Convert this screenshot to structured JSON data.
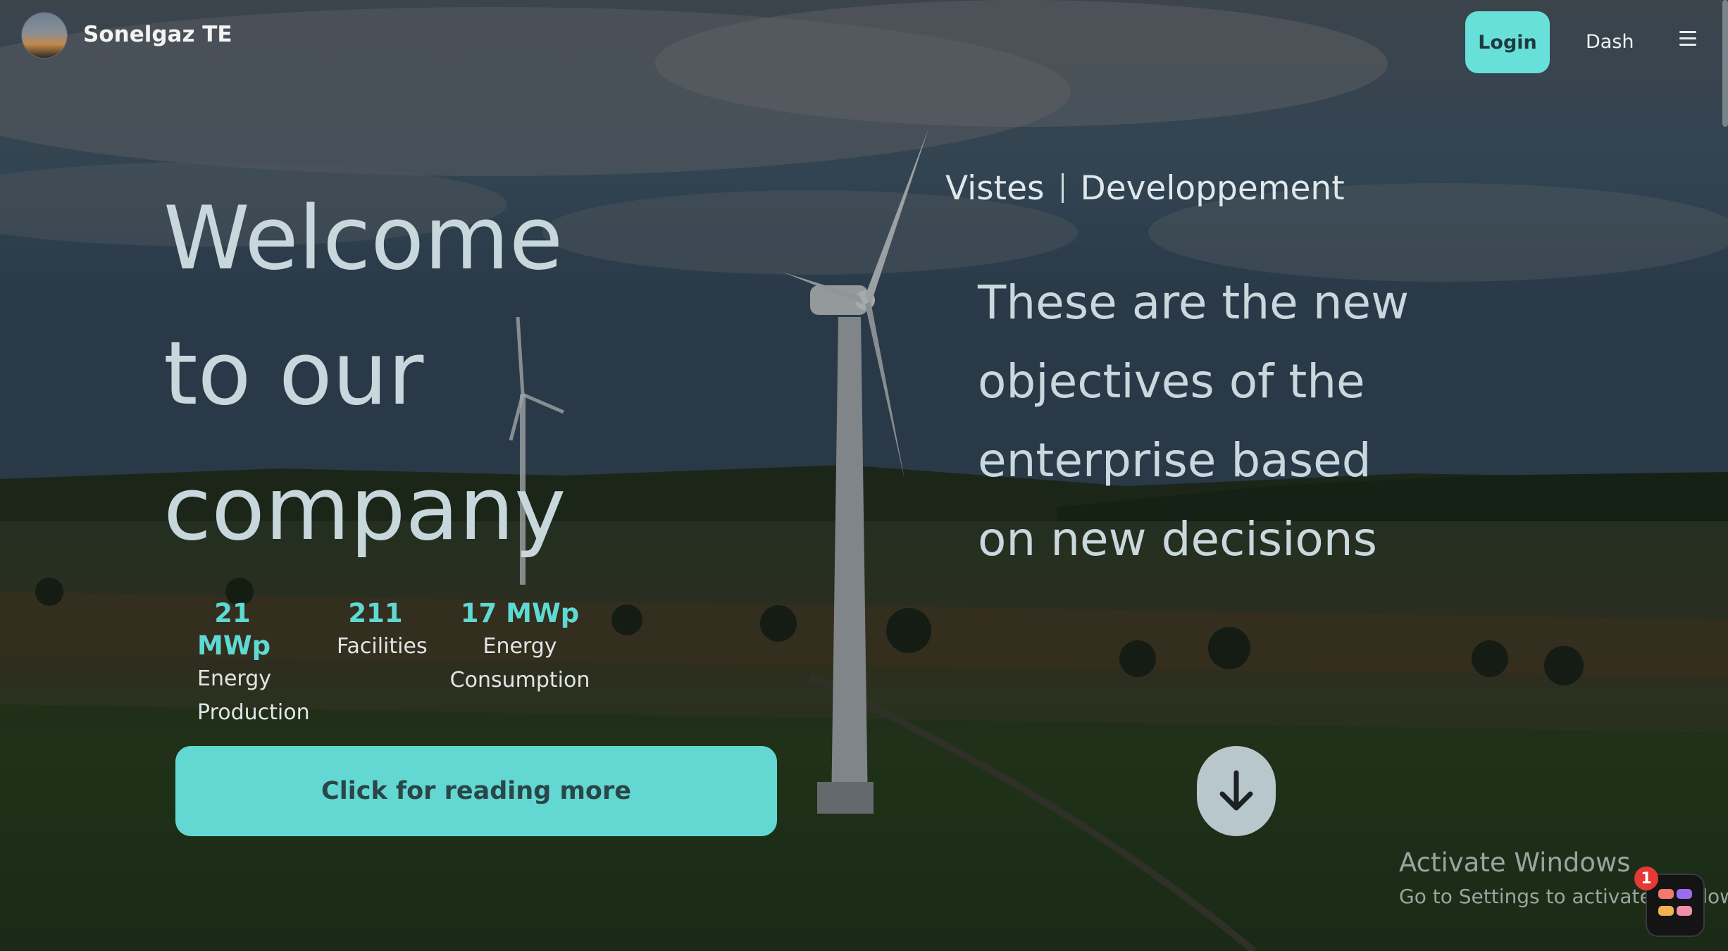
{
  "colors": {
    "accent": "#63d8d2",
    "stat_value": "#5fd9d3",
    "heading": "#c7d7db",
    "overlay": "#1d2622"
  },
  "nav": {
    "brand": "Sonelgaz TE",
    "login_label": "Login",
    "dash_label": "Dash",
    "menu_icon": "hamburger-icon"
  },
  "hero": {
    "welcome_lines": [
      "Welcome",
      "to our",
      "company"
    ],
    "stats": [
      {
        "value": "21 MWp",
        "label_line1": "Energy",
        "label_line2": "Production"
      },
      {
        "value": "211",
        "label_line1": "Facilities",
        "label_line2": ""
      },
      {
        "value": "17 MWp",
        "label_line1": "Energy",
        "label_line2": "Consumption"
      }
    ],
    "read_more_label": "Click for reading more",
    "tabs": [
      "Vistes",
      "Developpement"
    ],
    "objectives_lines": [
      "These are the new",
      "objectives of the",
      "enterprise based",
      "on new decisions"
    ],
    "scroll_icon": "arrow-down-icon"
  },
  "watermark": {
    "title": "Activate Windows",
    "subtitle": "Go to Settings to activate Windows.",
    "badge_count": "1"
  }
}
